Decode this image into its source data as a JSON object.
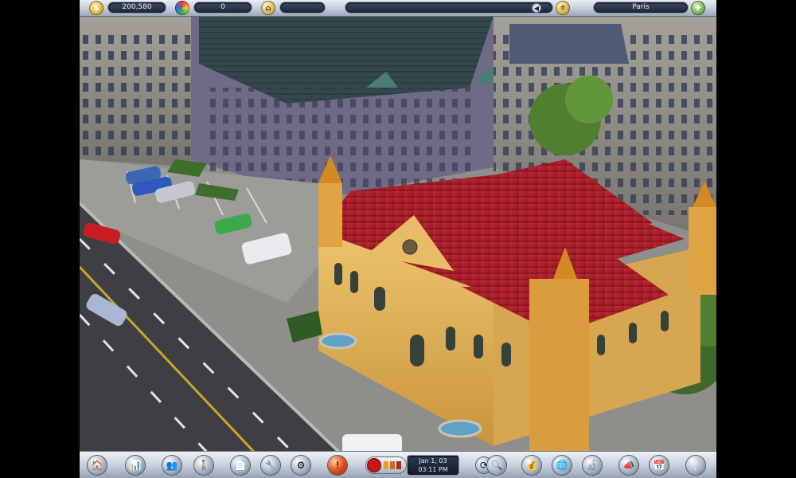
{
  "hud": {
    "money": "200,580",
    "population": "0",
    "rating": "",
    "message": "",
    "city": "Paris"
  },
  "clock": {
    "date": "Jan 1, 03",
    "time": "03:11 PM"
  },
  "icons": {
    "money": "coin-icon",
    "population": "globe-icon",
    "rating": "house-icon",
    "message": "alert-icon",
    "city": "city-icon",
    "map": "map-icon"
  },
  "colors": {
    "bar_light": "#e9eef4",
    "bar_dark": "#9ea9b8",
    "field_bg": "#1c2538",
    "roof": "#b5202c",
    "facade": "#e2b55c"
  }
}
